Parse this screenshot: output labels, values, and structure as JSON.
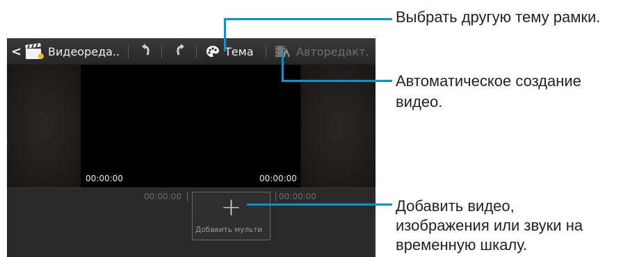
{
  "actionbar": {
    "back_glyph": "<",
    "title": "Видеореда..",
    "theme_label": "Тема",
    "autoedit_label": "Авторедакт."
  },
  "preview": {
    "time_left": "00:00:00",
    "time_right": "00:00:00"
  },
  "timeline": {
    "time_left": "00:00:00",
    "time_right": "00:00:00",
    "add_label": "Добавить мульти",
    "add_glyph": "+"
  },
  "annotations": {
    "theme": "Выбрать другую тему рамки.",
    "autoedit_line1": "Автоматическое создание",
    "autoedit_line2": "видео.",
    "add_line1": "Добавить видео,",
    "add_line2": "изображения или звуки на",
    "add_line3": "временную шкалу."
  },
  "colors": {
    "callout": "#0097d6",
    "actionbar": "#2e2e2e",
    "timeline": "#2a2a2a"
  }
}
